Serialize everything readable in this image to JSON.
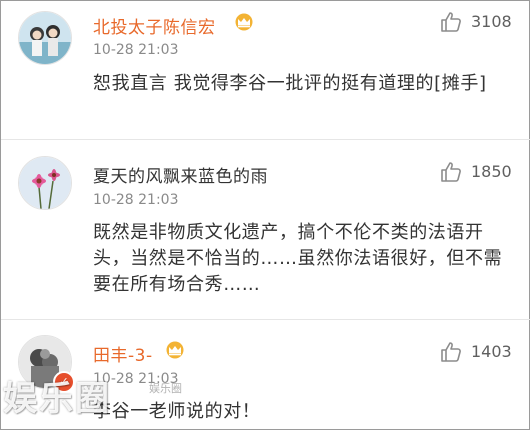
{
  "comments": [
    {
      "username": "北投太子陈信宏",
      "time": "10-28 21:03",
      "text": "恕我直言 我觉得李谷一批评的挺有道理的[摊手]",
      "likes": "3108",
      "verified_crown": true
    },
    {
      "username": "夏天的风飘来蓝色的雨",
      "time": "10-28 21:03",
      "text": "既然是非物质文化遗产，搞个不伦不类的法语开头，当然是不恰当的……虽然你法语很好，但不需要在所有场合秀……",
      "likes": "1850",
      "verified_crown": false
    },
    {
      "username": "田丰-3-",
      "time": "10-28 21:03",
      "text": "李谷一老师说的对！",
      "likes": "1403",
      "verified_crown": true
    }
  ],
  "watermark": {
    "logo_text": "娱乐圈",
    "small_text": "娱乐圈"
  },
  "colors": {
    "username_vip": "#e8692b",
    "username_regular": "#333333",
    "timestamp": "#8a8a8a",
    "like_icon": "#8c8c8c",
    "crown_gold": "#f3b334"
  },
  "icons": {
    "like": "thumbs-up-icon",
    "crown": "vip-crown-icon"
  }
}
